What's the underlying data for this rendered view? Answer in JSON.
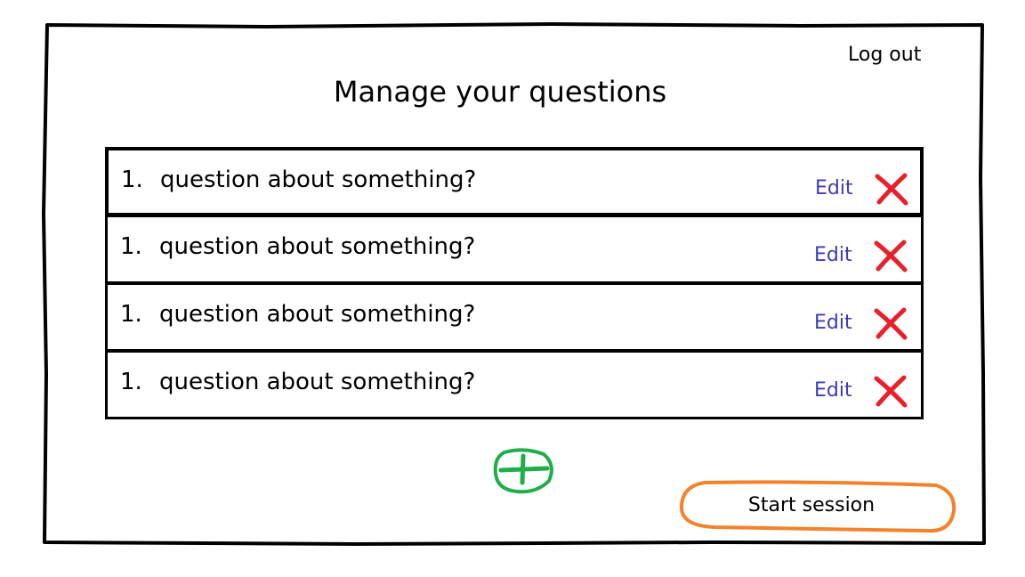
{
  "header": {
    "logout_label": "Log out",
    "title": "Manage your questions"
  },
  "questions": [
    {
      "number": "1.",
      "text": "question about something?",
      "edit_label": "Edit"
    },
    {
      "number": "1.",
      "text": "question about something?",
      "edit_label": "Edit"
    },
    {
      "number": "1.",
      "text": "question about something?",
      "edit_label": "Edit"
    },
    {
      "number": "1.",
      "text": "question about something?",
      "edit_label": "Edit"
    }
  ],
  "actions": {
    "add_icon": "plus-icon",
    "delete_icon": "close-icon",
    "start_label": "Start session"
  },
  "colors": {
    "edit_link": "#3b3bb8",
    "delete": "#e8202a",
    "add": "#1fae4a",
    "start_outline": "#f5822a"
  }
}
